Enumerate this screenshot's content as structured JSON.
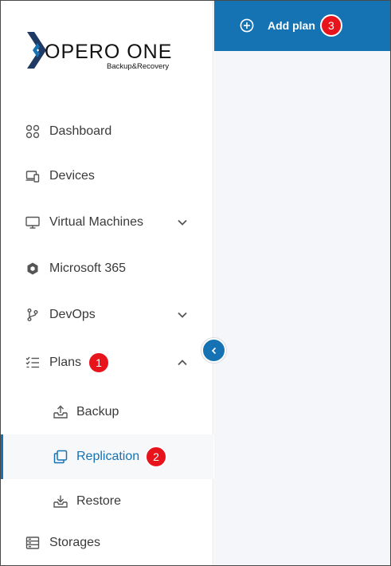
{
  "brand": {
    "name": "XOPERO ONE",
    "name_rest": "OPERO ONE",
    "tagline": "Backup&Recovery",
    "colors": {
      "dark": "#1f3a64",
      "accent": "#1573b4"
    }
  },
  "topbar": {
    "add_plan_label": "Add plan",
    "add_plan_icon": "plus-circle-icon",
    "badge": "3",
    "background": "#1573b4"
  },
  "sidebar": {
    "collapse_icon": "chevron-left-icon",
    "items": [
      {
        "label": "Dashboard",
        "icon": "dashboard-grid-icon"
      },
      {
        "label": "Devices",
        "icon": "devices-icon"
      },
      {
        "label": "Virtual Machines",
        "icon": "monitor-icon",
        "expandable": true,
        "expanded": false
      },
      {
        "label": "Microsoft 365",
        "icon": "microsoft-365-icon"
      },
      {
        "label": "DevOps",
        "icon": "git-branch-icon",
        "expandable": true,
        "expanded": false
      },
      {
        "label": "Plans",
        "icon": "checklist-icon",
        "expandable": true,
        "expanded": true,
        "badge": "1",
        "children": [
          {
            "label": "Backup",
            "icon": "upload-tray-icon"
          },
          {
            "label": "Replication",
            "icon": "copy-icon",
            "active": true,
            "badge": "2"
          },
          {
            "label": "Restore",
            "icon": "download-tray-icon"
          }
        ]
      },
      {
        "label": "Storages",
        "icon": "storage-icon"
      }
    ]
  },
  "badge_color": "#e8141b"
}
